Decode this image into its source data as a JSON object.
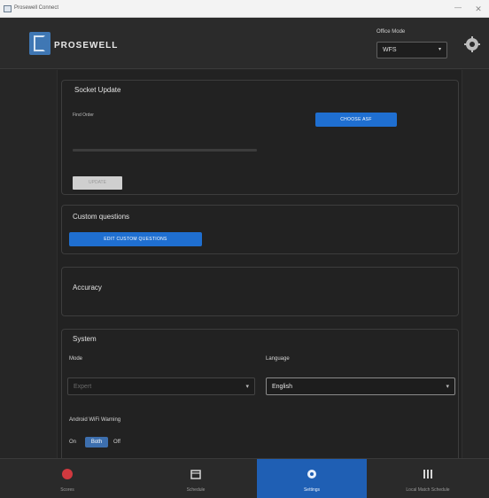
{
  "window": {
    "title": "Prosewell Connect",
    "minimize_glyph": "—",
    "close_glyph": "✕"
  },
  "header": {
    "logo_text": "PROSEWELL",
    "mode_label": "Office Mode",
    "mode_value": "WFS",
    "mode_caret": "▾"
  },
  "socket_update": {
    "title": "Socket Update",
    "file_label": "Find Order",
    "choose_button": "CHOOSE ASF",
    "update_button": "UPDATE",
    "progress": 0
  },
  "custom_questions": {
    "title": "Custom questions",
    "edit_button": "EDIT CUSTOM QUESTIONS"
  },
  "accuracy": {
    "title": "Accuracy"
  },
  "system": {
    "title": "System",
    "mode_label": "Mode",
    "mode_value": "Expert",
    "mode_caret": "▾",
    "language_label": "Language",
    "language_value": "English",
    "language_caret": "▾",
    "warning_label": "Android WiFi Warning",
    "toggle_on": "On",
    "toggle_both": "Both",
    "toggle_off": "Off"
  },
  "nav": {
    "items": [
      {
        "label": "Scores",
        "icon": "scores-icon"
      },
      {
        "label": "Schedule",
        "icon": "schedule-icon"
      },
      {
        "label": "Settings",
        "icon": "settings-icon"
      },
      {
        "label": "Local Match Schedule",
        "icon": "match-schedule-icon"
      }
    ],
    "active_index": 2
  },
  "colors": {
    "accent": "#1f6fd1",
    "active_tab": "#1f5fb4",
    "scores_icon": "#d0393f",
    "background": "#262626"
  }
}
